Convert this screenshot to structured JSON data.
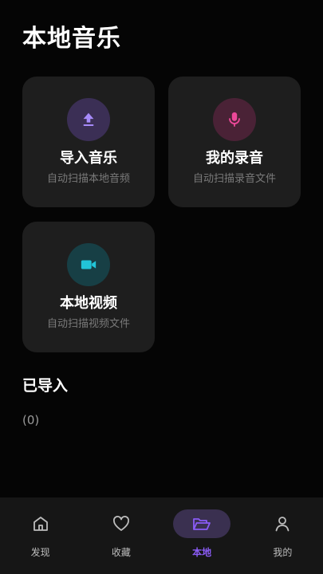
{
  "header": {
    "title": "本地音乐"
  },
  "cards": [
    {
      "title": "导入音乐",
      "subtitle": "自动扫描本地音频",
      "icon": "upload-icon",
      "icon_color": "#a78bfa",
      "icon_bg": "#3b2f55"
    },
    {
      "title": "我的录音",
      "subtitle": "自动扫描录音文件",
      "icon": "microphone-icon",
      "icon_color": "#ec4899",
      "icon_bg": "#4a2236"
    },
    {
      "title": "本地视频",
      "subtitle": "自动扫描视频文件",
      "icon": "video-camera-icon",
      "icon_color": "#22c5d8",
      "icon_bg": "#173f45"
    }
  ],
  "imported": {
    "title": "已导入",
    "count_text": "(0)"
  },
  "nav": {
    "items": [
      {
        "label": "发现",
        "icon": "home-icon"
      },
      {
        "label": "收藏",
        "icon": "heart-icon"
      },
      {
        "label": "本地",
        "icon": "folder-open-icon",
        "active": true
      },
      {
        "label": "我的",
        "icon": "user-icon"
      }
    ],
    "active_color": "#8b5cf6"
  }
}
